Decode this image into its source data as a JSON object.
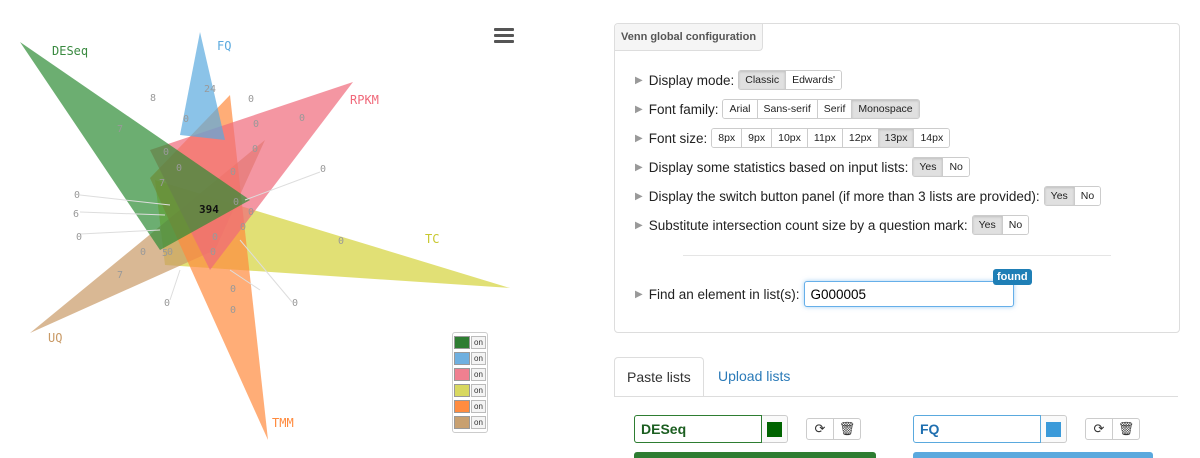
{
  "venn": {
    "labels": {
      "deseq": "DESeq",
      "fq": "FQ",
      "rpkm": "RPKM",
      "tc": "TC",
      "uq": "UQ",
      "tmm": "TMM"
    },
    "center_count": "394",
    "counts": [
      "8",
      "24",
      "0",
      "0",
      "7",
      "0",
      "0",
      "0",
      "0",
      "0",
      "0",
      "0",
      "0",
      "6",
      "0",
      "0",
      "7",
      "0",
      "0",
      "0",
      "7",
      "0",
      "0",
      "0",
      "0",
      "0",
      "5",
      "0",
      "0",
      "0"
    ],
    "colors": {
      "deseq": "#2e8b35",
      "fq": "#5aa9de",
      "rpkm": "#f0697a",
      "tc": "#d4d33a",
      "uq": "#c99a66",
      "tmm": "#ff8a3d"
    }
  },
  "switches": [
    {
      "name": "deseq",
      "label": "on",
      "color": "#2e7d32"
    },
    {
      "name": "fq",
      "label": "on",
      "color": "#6fb0e0"
    },
    {
      "name": "rpkm",
      "label": "on",
      "color": "#f08090"
    },
    {
      "name": "tc",
      "label": "on",
      "color": "#d8d860"
    },
    {
      "name": "tmm",
      "label": "on",
      "color": "#ff8c40"
    },
    {
      "name": "uq",
      "label": "on",
      "color": "#c8a070"
    }
  ],
  "config": {
    "title": "Venn global configuration",
    "display_mode": {
      "label": "Display mode:",
      "options": [
        "Classic",
        "Edwards'"
      ],
      "active": "Classic"
    },
    "font_family": {
      "label": "Font family:",
      "options": [
        "Arial",
        "Sans-serif",
        "Serif",
        "Monospace"
      ],
      "active": "Monospace"
    },
    "font_size": {
      "label": "Font size:",
      "options": [
        "8px",
        "9px",
        "10px",
        "11px",
        "12px",
        "13px",
        "14px"
      ],
      "active": "13px"
    },
    "stats": {
      "label": "Display some statistics based on input lists:",
      "options": [
        "Yes",
        "No"
      ],
      "active": "Yes"
    },
    "switch_panel": {
      "label": "Display the switch button panel (if more than 3 lists are provided):",
      "options": [
        "Yes",
        "No"
      ],
      "active": "Yes"
    },
    "substitute": {
      "label": "Substitute intersection count size by a question mark:",
      "options": [
        "Yes",
        "No"
      ],
      "active": "Yes"
    },
    "find": {
      "label": "Find an element in list(s):",
      "value": "G000005",
      "badge": "found"
    }
  },
  "tabs": {
    "paste": "Paste lists",
    "upload": "Upload lists"
  },
  "lists": [
    {
      "name": "DESeq",
      "color": "#006400",
      "border": "#2e7d32"
    },
    {
      "name": "FQ",
      "color": "#3b9ad9",
      "border": "#5aa9de"
    }
  ],
  "icons": {
    "refresh": "⟳",
    "trash": "🗑"
  }
}
